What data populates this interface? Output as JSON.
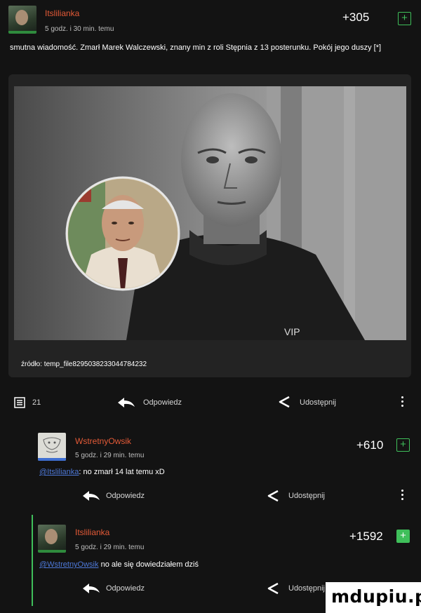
{
  "post": {
    "username": "Itslilianka",
    "timestamp": "5 godz. i 30 min. temu",
    "score": "+305",
    "plus_symbol": "+",
    "text": "smutna wiadomość. Zmarł Marek Walczewski, znany min z roli Stępnia z 13 posterunku. Pokój jego duszy [*]",
    "source": "źródło: temp_file8295038233044784232",
    "comments_count": "21",
    "reply_label": "Odpowiedz",
    "share_label": "Udostępnij"
  },
  "comments": [
    {
      "username": "WstretnyOwsik",
      "timestamp": "5 godz. i 29 min. temu",
      "score": "+610",
      "mention": "@Itslilianka",
      "text": ": no zmarł 14 lat temu xD",
      "reply_label": "Odpowiedz",
      "share_label": "Udostępnij"
    },
    {
      "username": "Itslilianka",
      "timestamp": "5 godz. i 29 min. temu",
      "score": "+1592",
      "mention": "@WstretnyOwsik",
      "text": " no ale się dowiedziałem dziś",
      "reply_label": "Odpowiedz",
      "share_label": "Udostępnij"
    }
  ],
  "watermark": "mdupiu.pl",
  "colors": {
    "username": "#e35a37",
    "accent_green": "#3fbf5a",
    "mention": "#4d78d8",
    "background": "#131313"
  },
  "icons": [
    "comments-icon",
    "reply-arrow-icon",
    "share-icon",
    "more-dots-icon",
    "plus-box-icon"
  ]
}
